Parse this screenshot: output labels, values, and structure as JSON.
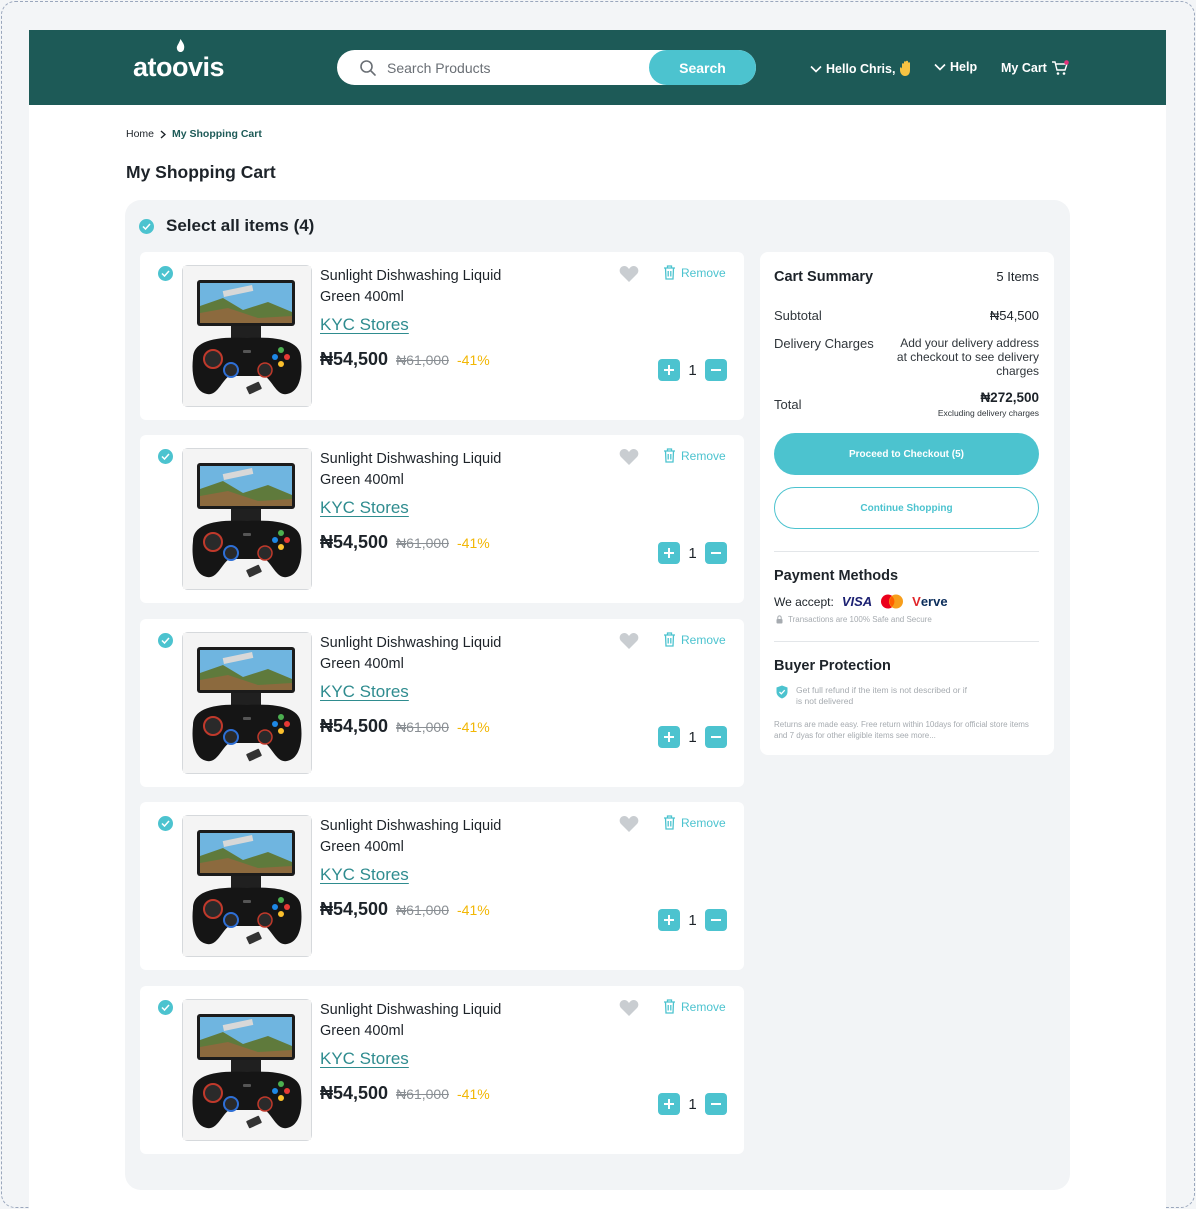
{
  "header": {
    "logo": "atoovis",
    "search": {
      "placeholder": "Search Products",
      "value": "",
      "button_label": "Search"
    },
    "nav": {
      "greeting": "Hello Chris,",
      "help": "Help",
      "cart": "My Cart"
    },
    "colors": {
      "bar": "#1d5a57",
      "accent": "#4cc3cf"
    }
  },
  "breadcrumb": {
    "home": "Home",
    "current": "My Shopping Cart"
  },
  "page_title": "My Shopping Cart",
  "cart": {
    "select_all_label": "Select all items (4)",
    "remove_label": "Remove",
    "items": [
      {
        "name": "Sunlight Dishwashing Liquid Green 400ml",
        "store": "KYC Stores",
        "price": "₦54,500",
        "old_price": "₦61,000",
        "discount": "-41%",
        "qty": "1",
        "icon": "gamepad-phone-image"
      },
      {
        "name": "Sunlight Dishwashing Liquid Green 400ml",
        "store": "KYC Stores",
        "price": "₦54,500",
        "old_price": "₦61,000",
        "discount": "-41%",
        "qty": "1",
        "icon": "gamepad-phone-image"
      },
      {
        "name": "Sunlight Dishwashing Liquid Green 400ml",
        "store": "KYC Stores",
        "price": "₦54,500",
        "old_price": "₦61,000",
        "discount": "-41%",
        "qty": "1",
        "icon": "gamepad-phone-image"
      },
      {
        "name": "Sunlight Dishwashing Liquid Green 400ml",
        "store": "KYC Stores",
        "price": "₦54,500",
        "old_price": "₦61,000",
        "discount": "-41%",
        "qty": "1",
        "icon": "gamepad-phone-image"
      },
      {
        "name": "Sunlight Dishwashing Liquid Green 400ml",
        "store": "KYC Stores",
        "price": "₦54,500",
        "old_price": "₦61,000",
        "discount": "-41%",
        "qty": "1",
        "icon": "gamepad-phone-image"
      }
    ]
  },
  "summary": {
    "title": "Cart Summary",
    "item_count": "5 Items",
    "subtotal_label": "Subtotal",
    "subtotal_value": "₦54,500",
    "delivery_label": "Delivery Charges",
    "delivery_note": "Add your delivery address at checkout to see delivery charges",
    "total_label": "Total",
    "total_value": "₦272,500",
    "total_note": "Excluding delivery charges",
    "checkout_label": "Proceed to Checkout (5)",
    "continue_label": "Continue Shopping",
    "payment": {
      "title": "Payment Methods",
      "accept_label": "We accept:",
      "visa": "VISA",
      "verve_v": "V",
      "verve_rest": "erve",
      "secure_note": "Transactions are 100% Safe and Secure"
    },
    "protection": {
      "title": "Buyer Protection",
      "refund_note": "Get full refund if the item is not described or if is not delivered",
      "returns_note": "Returns are made easy. Free return within 10days for official store items and 7 dyas for other eligible items see more..."
    }
  }
}
